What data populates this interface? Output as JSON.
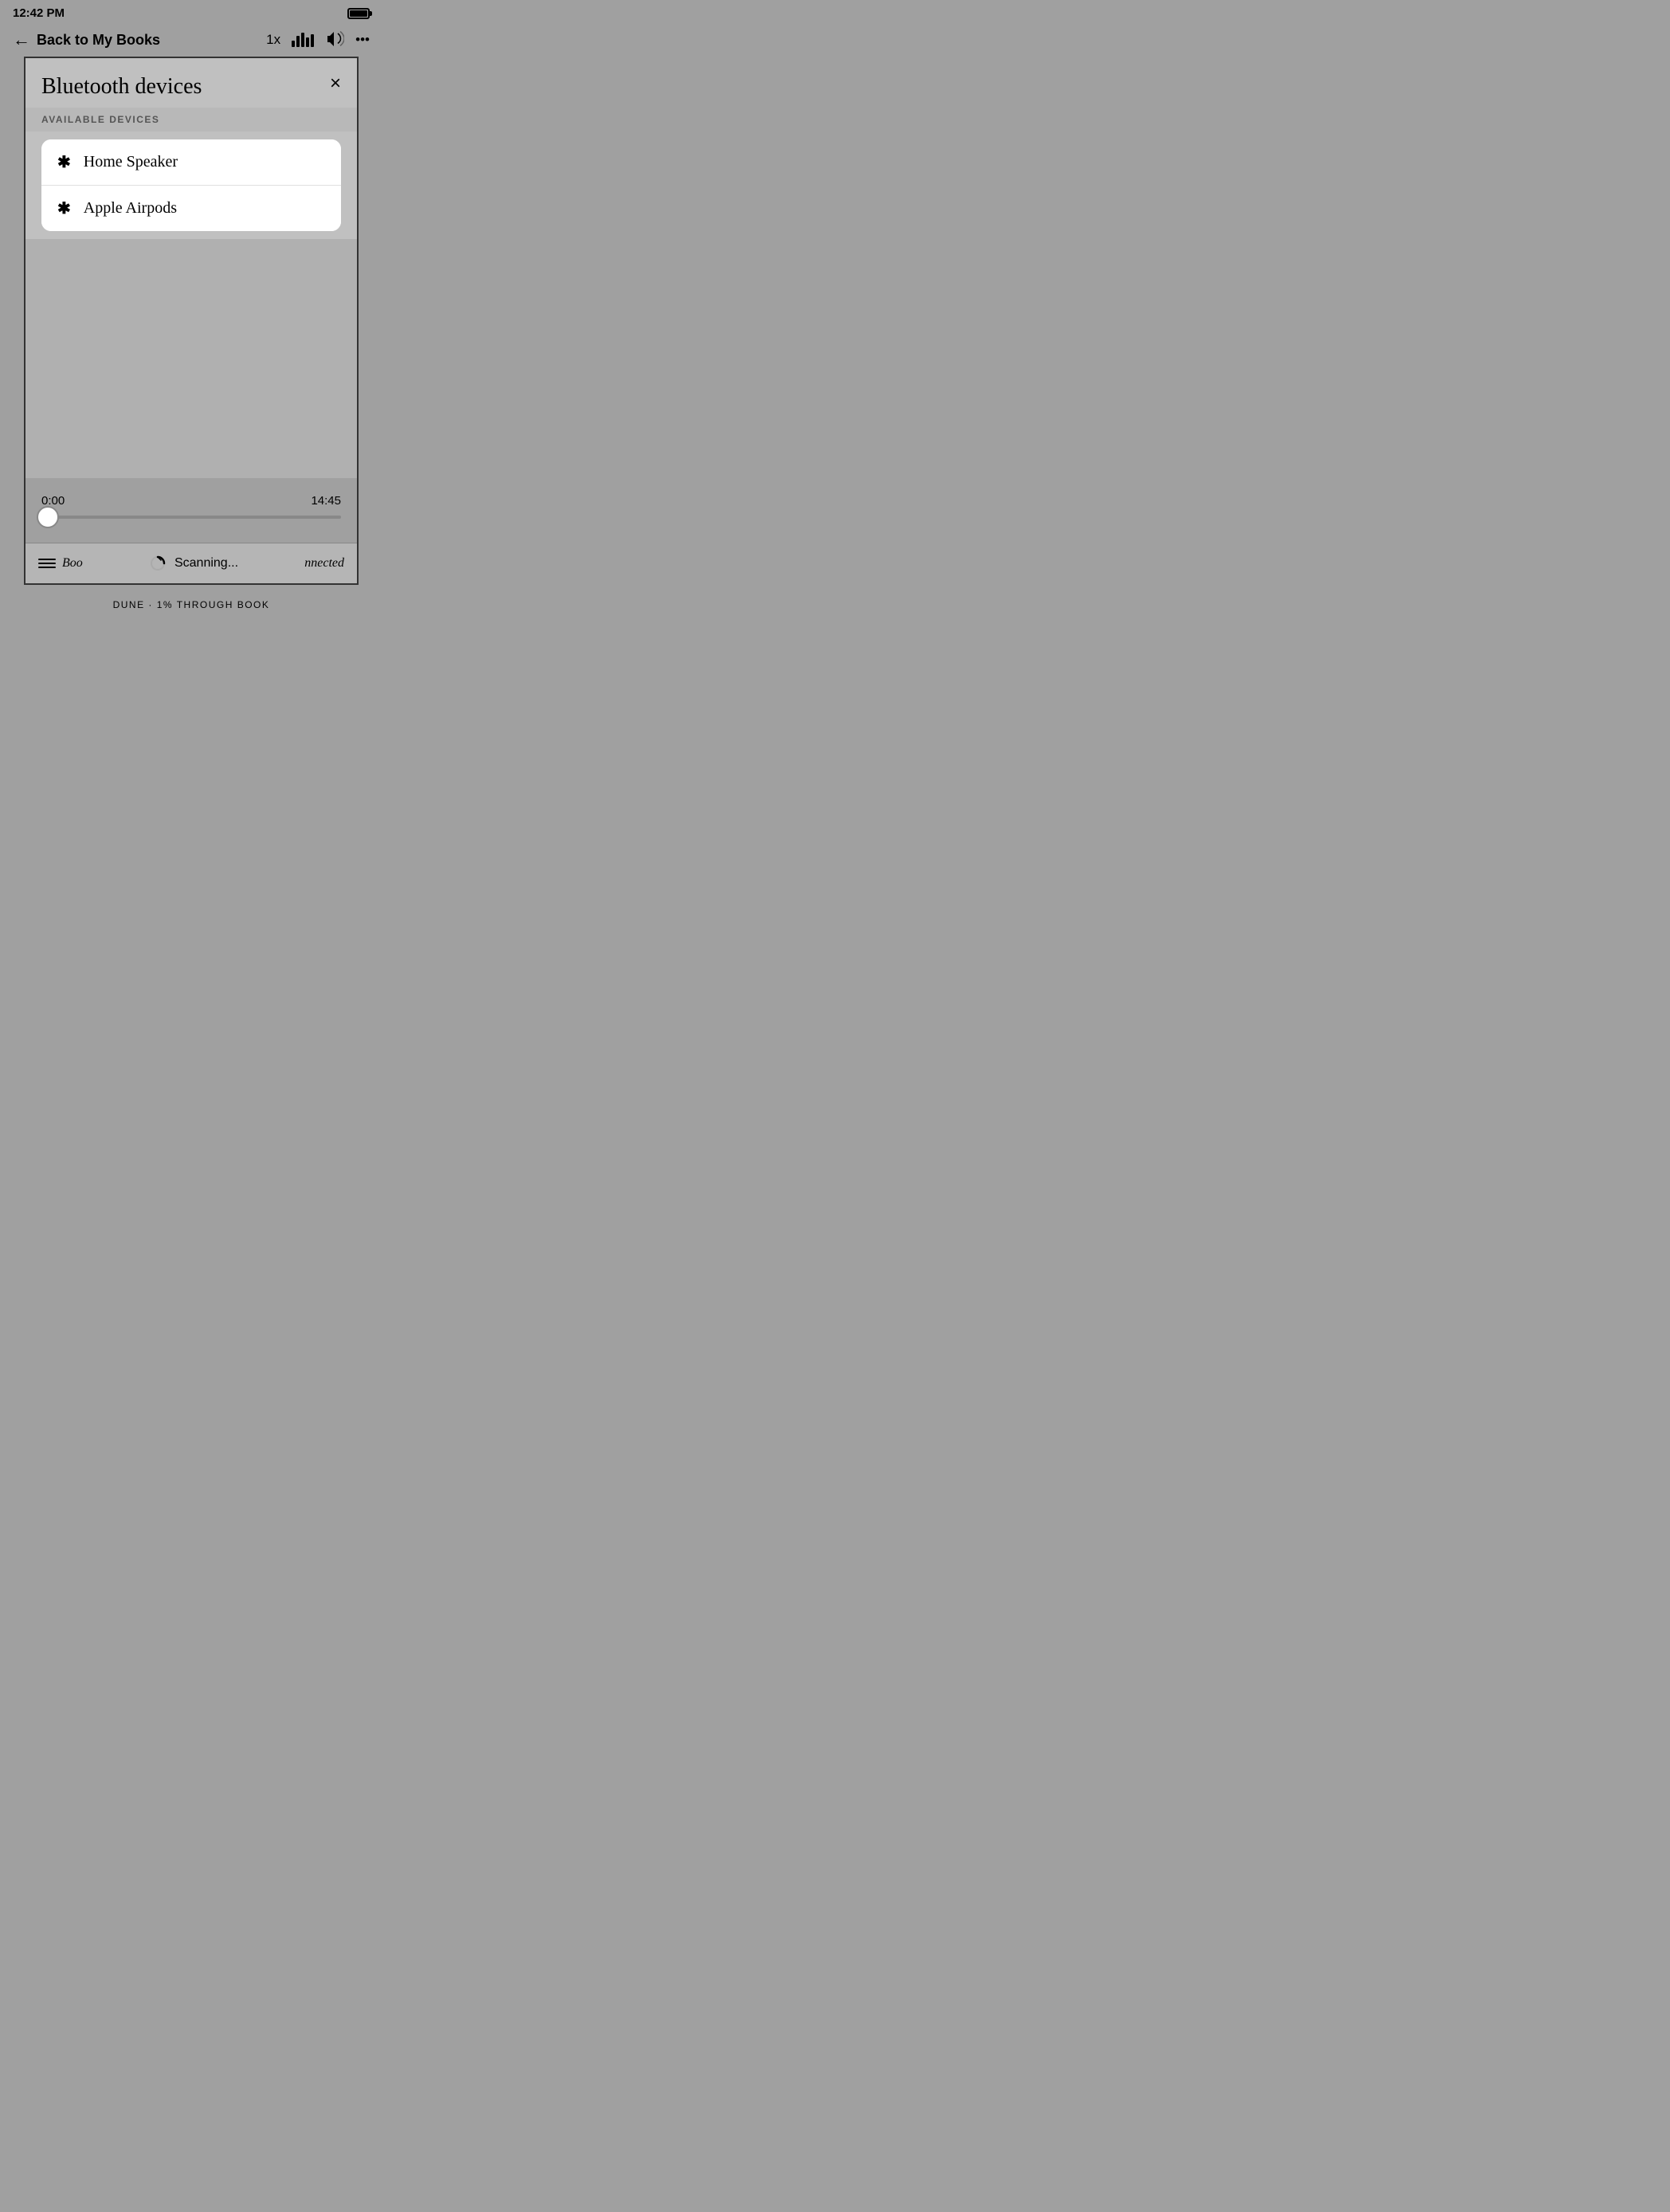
{
  "statusBar": {
    "time": "12:42 PM",
    "batteryLevel": "full"
  },
  "navBar": {
    "backLabel": "Back to My Books",
    "speedLabel": "1x",
    "moreLabel": "•••"
  },
  "modal": {
    "title": "Bluetooth devices",
    "sectionLabel": "AVAILABLE DEVICES",
    "closeLabel": "×",
    "devices": [
      {
        "name": "Home Speaker"
      },
      {
        "name": "Apple Airpods"
      }
    ]
  },
  "player": {
    "timeStart": "0:00",
    "timeEnd": "14:45",
    "progressPercent": 2
  },
  "toolbar": {
    "bookmarksLabel": "Boo",
    "scanningLabel": "Scanning...",
    "connectedLabel": "nnected"
  },
  "footer": {
    "text": "DUNE · 1% THROUGH BOOK"
  }
}
